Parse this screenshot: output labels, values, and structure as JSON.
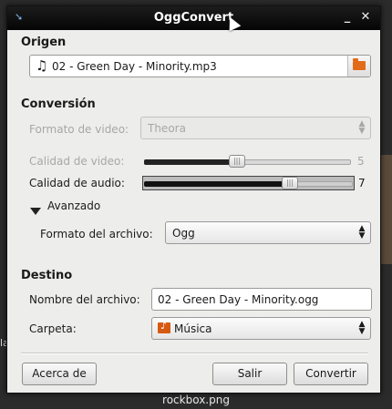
{
  "window": {
    "title": "OggConvert"
  },
  "desktop": {
    "file_label": "rockbox.png"
  },
  "origen": {
    "heading": "Origen",
    "file_name": "02 - Green Day - Minority.mp3",
    "icon": "music-note-icon"
  },
  "conversion": {
    "heading": "Conversión",
    "video_format_label": "Formato de video:",
    "video_format_value": "Theora",
    "video_quality_label": "Calidad de video:",
    "video_quality_value": "5",
    "video_quality_fraction": 0.45,
    "audio_quality_label": "Calidad de audio:",
    "audio_quality_value": "7",
    "audio_quality_fraction": 0.7,
    "advanced_label": "Avanzado",
    "file_format_label": "Formato del archivo:",
    "file_format_value": "Ogg"
  },
  "destino": {
    "heading": "Destino",
    "file_name_label": "Nombre del archivo:",
    "file_name_value": "02 - Green Day - Minority.ogg",
    "folder_label": "Carpeta:",
    "folder_value": "Música"
  },
  "buttons": {
    "about": "Acerca de",
    "quit": "Salir",
    "convert": "Convertir"
  }
}
